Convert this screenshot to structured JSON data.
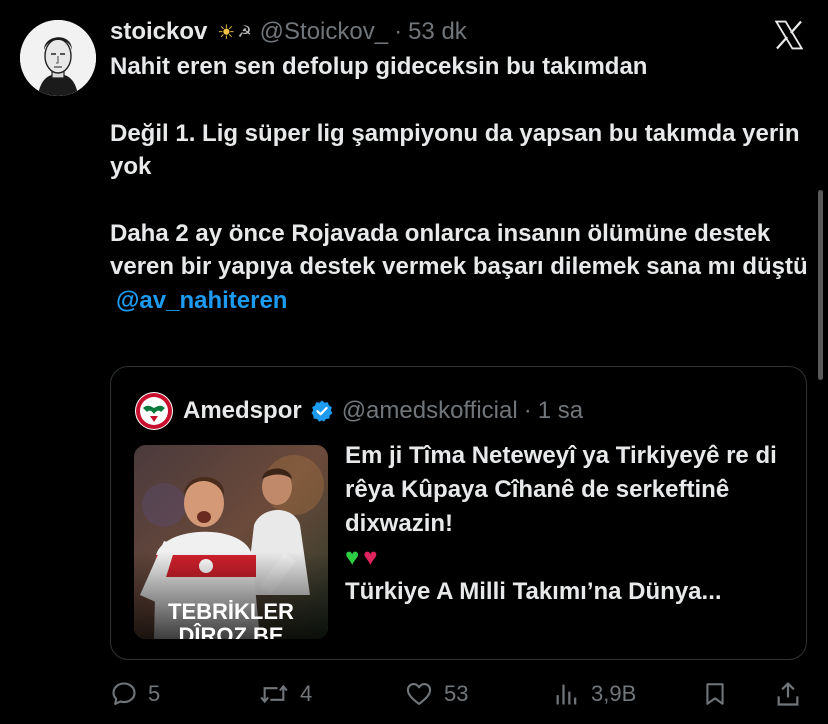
{
  "tweet": {
    "author_name": "stoickov",
    "author_emojis": [
      "sun",
      "hammer-and-sickle"
    ],
    "handle": "@Stoickov_",
    "separator": "·",
    "time": "53 dk",
    "paragraphs": [
      "Nahit eren sen defolup gideceksin bu takımdan",
      "Değil 1. Lig süper lig şampiyonu da yapsan bu takımda yerin yok",
      "Daha 2 ay önce Rojavada onlarca insanın ölümüne destek veren bir yapıya destek vermek başarı dilemek sana mı düştü"
    ],
    "mention": "@av_nahiteren"
  },
  "quote": {
    "name": "Amedspor",
    "verified": true,
    "handle": "@amedskofficial",
    "separator": "·",
    "time": "1 sa",
    "lines": [
      "Em ji Tîma Neteweyî ya Tirkiyeyê re di rêya Kûpaya Cîhanê de serkeftinê dixwazin!",
      "Türkiye A Milli Takımı’na Dünya..."
    ],
    "hearts": [
      "green-heart",
      "red-heart"
    ],
    "image_overlay_line1": "TEBRİKLER",
    "image_overlay_line2": "DÎROZ BE"
  },
  "actions": {
    "replies": "5",
    "reposts": "4",
    "likes": "53",
    "views": "3,9B"
  },
  "colors": {
    "background": "#000000",
    "text": "#e7e9ea",
    "muted": "#71767b",
    "link": "#1d9bf0",
    "border": "#2f3336"
  }
}
